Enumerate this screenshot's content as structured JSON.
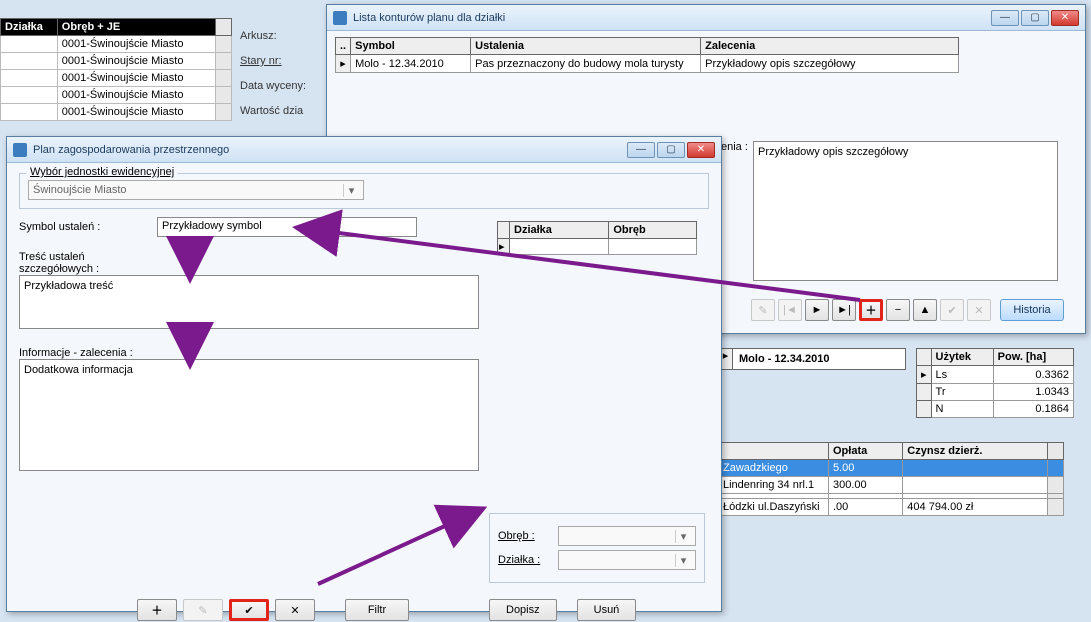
{
  "bg_table": {
    "headers": [
      "Działka",
      "Obręb + JE"
    ],
    "rows": [
      [
        "",
        "0001-Świnoujście Miasto"
      ],
      [
        "",
        "0001-Świnoujście Miasto"
      ],
      [
        "",
        "0001-Świnoujście Miasto"
      ],
      [
        "",
        "0001-Świnoujście Miasto"
      ],
      [
        "",
        "0001-Świnoujście Miasto"
      ]
    ]
  },
  "bg_labels": {
    "arkusz": "Arkusz:",
    "stary_nr": "Stary nr:",
    "data_wyceny": "Data wyceny:",
    "wartosc": "Wartość dzia"
  },
  "winA": {
    "title": "Lista konturów planu dla działki",
    "headers": {
      "symbol": "Symbol",
      "ustalenia": "Ustalenia",
      "zalecenia": "Zalecenia"
    },
    "row": {
      "symbol": "Molo - 12.34.2010",
      "ustalenia": "Pas przeznaczony do budowy mola turysty",
      "zalecenia": "Przykładowy opis szczegółowy"
    },
    "opis_label": "enia :",
    "opis_text": "Przykładowy opis szczegółowy",
    "historia": "Historia",
    "midrow": "Molo - 12.34.2010"
  },
  "rtab": {
    "headers": {
      "uzytek": "Użytek",
      "pow": "Pow. [ha]"
    },
    "rows": [
      {
        "u": "Ls",
        "p": "0.3362"
      },
      {
        "u": "Tr",
        "p": "1.0343"
      },
      {
        "u": "N",
        "p": "0.1864"
      }
    ]
  },
  "btab": {
    "headers": {
      "oplata": "Opłata",
      "czynsz": "Czynsz dzierż."
    },
    "rows": [
      {
        "addr": "Zawadzkiego",
        "op": "5.00",
        "cz": ""
      },
      {
        "addr": "Lindenring 34 nrl.1",
        "op": "300.00",
        "cz": ""
      },
      {
        "addr": "",
        "op": "",
        "cz": ""
      },
      {
        "addr": "Łódzki ul.Daszyński",
        "op": ".00",
        "cz": "404 794.00 zł"
      }
    ]
  },
  "winB": {
    "title": "Plan zagospodarowania przestrzennego",
    "group_legend": "Wybór jednostki ewidencyjnej",
    "combo_value": "Świnoujście Miasto",
    "symbol_label": "Symbol ustaleń :",
    "symbol_value": "Przykładowy symbol",
    "tresc_label": "Treść ustaleń szczegółowych :",
    "tresc_value": "Przykładowa treść",
    "info_label": "Informacje - zalecenia :",
    "info_value": "Dodatkowa informacja",
    "right_headers": {
      "dzialka": "Działka",
      "obreb": "Obręb"
    },
    "obreb_label": "Obręb :",
    "dzialka_label": "Działka :",
    "dopisz": "Dopisz",
    "usun": "Usuń",
    "filtr": "Filtr"
  },
  "icons": {
    "plus": "＋",
    "minus": "−",
    "check": "✔",
    "x": "✕",
    "first": "|◄",
    "prev": "◄",
    "next": "►",
    "last": "►|",
    "up": "▲",
    "edit": "✎",
    "chev": "▾",
    "mark": "▸"
  }
}
